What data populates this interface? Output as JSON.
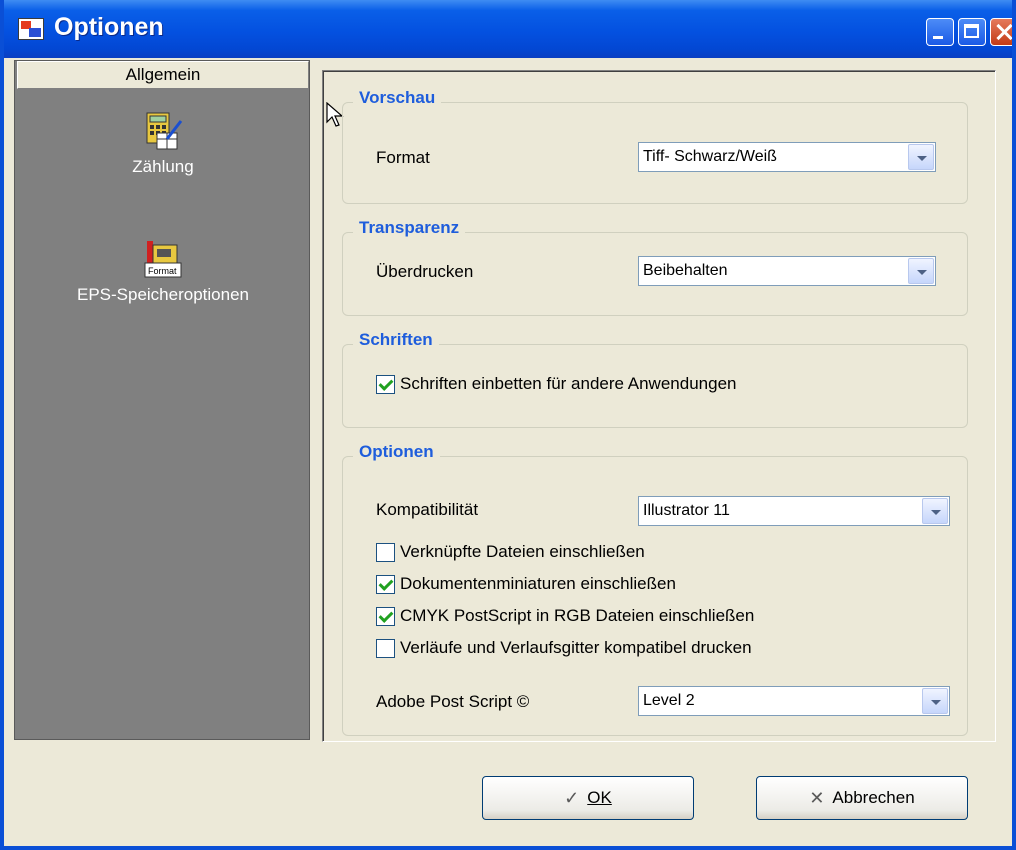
{
  "window": {
    "title": "Optionen"
  },
  "sidebar": {
    "header": "Allgemein",
    "items": [
      {
        "label": "Zählung",
        "icon": "calculator-icon"
      },
      {
        "label": "EPS-Speicheroptionen",
        "icon": "format-icon"
      }
    ]
  },
  "preview": {
    "legend": "Vorschau",
    "format_label": "Format",
    "format_value": "Tiff- Schwarz/Weiß"
  },
  "transparency": {
    "legend": "Transparenz",
    "overprint_label": "Überdrucken",
    "overprint_value": "Beibehalten"
  },
  "fonts": {
    "legend": "Schriften",
    "embed_label": "Schriften einbetten für andere Anwendungen",
    "embed_checked": true
  },
  "options": {
    "legend": "Optionen",
    "compat_label": "Kompatibilität",
    "compat_value": "Illustrator 11",
    "checkboxes": [
      {
        "label": "Verknüpfte Dateien einschließen",
        "checked": false
      },
      {
        "label": "Dokumentenminiaturen einschließen",
        "checked": true
      },
      {
        "label": "CMYK PostScript in RGB Dateien einschließen",
        "checked": true
      },
      {
        "label": "Verläufe und Verlaufsgitter kompatibel drucken",
        "checked": false
      }
    ],
    "postscript_label": "Adobe Post Script ©",
    "postscript_value": "Level 2"
  },
  "buttons": {
    "ok": "OK",
    "cancel": "Abbrechen"
  },
  "colors": {
    "title_blue": "#0451e0",
    "legend_blue": "#1e5ddc",
    "sidebar_gray": "#808080",
    "face": "#ece9d8"
  }
}
